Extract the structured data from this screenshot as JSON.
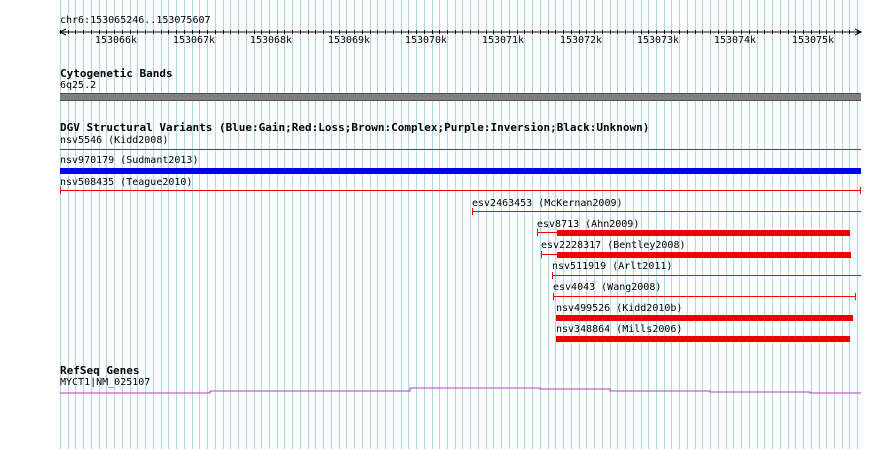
{
  "ruler": {
    "region_label": "chr6:153065246..153075607",
    "ticks": [
      "153066k",
      "153067k",
      "153068k",
      "153069k",
      "153070k",
      "153071k",
      "153072k",
      "153073k",
      "153074k",
      "153075k"
    ]
  },
  "tracks": {
    "cytoband": {
      "title": "Cytogenetic Bands",
      "band_label": "6q25.2"
    },
    "dgv": {
      "title": "DGV Structural Variants (Blue:Gain;Red:Loss;Brown:Complex;Purple:Inversion;Black:Unknown)",
      "features": [
        {
          "label": "nsv5546 (Kidd2008)",
          "type": "loss",
          "style": "line"
        },
        {
          "label": "nsv970179 (Sudmant2013)",
          "type": "gain",
          "style": "thick"
        },
        {
          "label": "nsv508435 (Teague2010)",
          "type": "loss",
          "style": "line"
        },
        {
          "label": "esv2463453 (McKernan2009)",
          "type": "loss",
          "style": "line"
        },
        {
          "label": "esv8713 (Ahn2009)",
          "type": "loss",
          "style": "thick-partial"
        },
        {
          "label": "esv2228317 (Bentley2008)",
          "type": "loss",
          "style": "thick-partial"
        },
        {
          "label": "nsv511919 (Arlt2011)",
          "type": "loss",
          "style": "line"
        },
        {
          "label": "esv4043 (Wang2008)",
          "type": "loss",
          "style": "line"
        },
        {
          "label": "nsv499526 (Kidd2010b)",
          "type": "loss",
          "style": "thick"
        },
        {
          "label": "nsv348864 (Mills2006)",
          "type": "loss",
          "style": "thick"
        }
      ]
    },
    "refseq": {
      "title": "RefSeq Genes",
      "gene_label": "MYCT1|NM_025107"
    }
  },
  "colors": {
    "gain": "#0000ee",
    "loss": "#ee0000",
    "gene": "#b040c0",
    "grid": "#add8e6",
    "band": "#808080"
  }
}
